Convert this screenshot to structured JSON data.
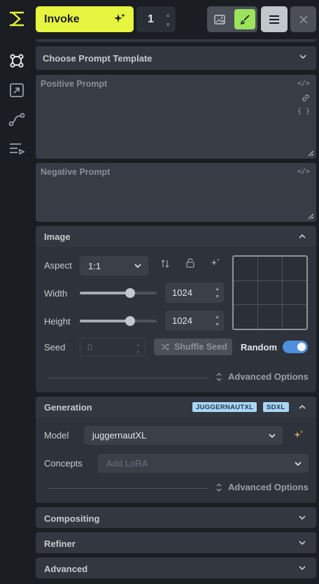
{
  "toolbar": {
    "invoke_label": "Invoke",
    "quantity": "1"
  },
  "prompt_template": {
    "label": "Choose Prompt Template"
  },
  "positive_prompt": {
    "placeholder": "Positive Prompt",
    "icons": [
      "</>",
      "link",
      "{ }"
    ]
  },
  "negative_prompt": {
    "placeholder": "Negative Prompt",
    "icons": [
      "</>"
    ]
  },
  "image_section": {
    "title": "Image",
    "aspect_label": "Aspect",
    "aspect_value": "1:1",
    "width_label": "Width",
    "width_value": "1024",
    "width_fraction": 0.65,
    "height_label": "Height",
    "height_value": "1024",
    "height_fraction": 0.65,
    "seed_label": "Seed",
    "seed_value": "0",
    "shuffle_label": "Shuffle Seed",
    "random_label": "Random",
    "random_on": true,
    "advanced_label": "Advanced Options"
  },
  "generation_section": {
    "title": "Generation",
    "badges": [
      "JUGGERNAUTXL",
      "SDXL"
    ],
    "model_label": "Model",
    "model_value": "juggernautXL",
    "concepts_label": "Concepts",
    "concepts_placeholder": "Add LoRA",
    "advanced_label": "Advanced Options"
  },
  "collapsed_sections": {
    "compositing": "Compositing",
    "refiner": "Refiner",
    "advanced": "Advanced"
  },
  "colors": {
    "accent": "#e6f53f",
    "active_tool": "#9be35a",
    "toggle": "#4f8fe0",
    "badge": "#a9d6f5"
  }
}
